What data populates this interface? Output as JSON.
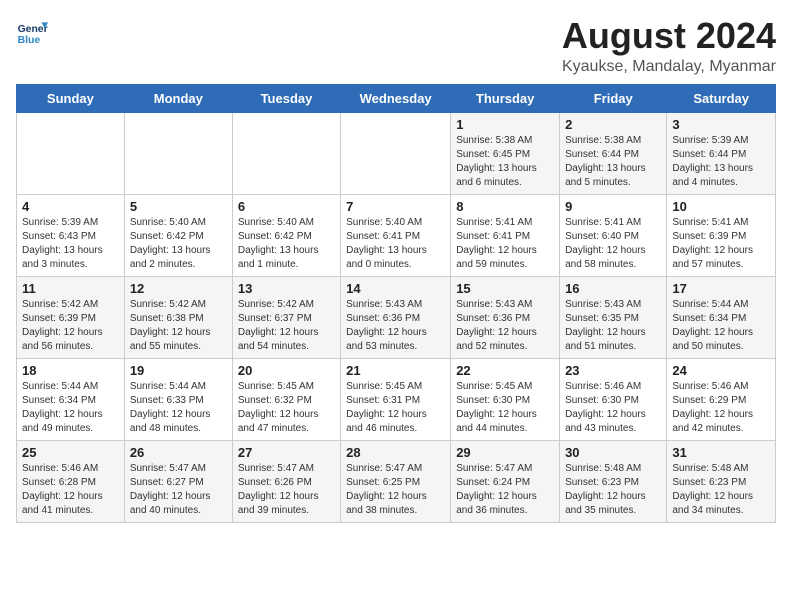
{
  "header": {
    "logo_line1": "General",
    "logo_line2": "Blue",
    "title": "August 2024",
    "subtitle": "Kyaukse, Mandalay, Myanmar"
  },
  "weekdays": [
    "Sunday",
    "Monday",
    "Tuesday",
    "Wednesday",
    "Thursday",
    "Friday",
    "Saturday"
  ],
  "weeks": [
    [
      {
        "day": "",
        "info": ""
      },
      {
        "day": "",
        "info": ""
      },
      {
        "day": "",
        "info": ""
      },
      {
        "day": "",
        "info": ""
      },
      {
        "day": "1",
        "info": "Sunrise: 5:38 AM\nSunset: 6:45 PM\nDaylight: 13 hours\nand 6 minutes."
      },
      {
        "day": "2",
        "info": "Sunrise: 5:38 AM\nSunset: 6:44 PM\nDaylight: 13 hours\nand 5 minutes."
      },
      {
        "day": "3",
        "info": "Sunrise: 5:39 AM\nSunset: 6:44 PM\nDaylight: 13 hours\nand 4 minutes."
      }
    ],
    [
      {
        "day": "4",
        "info": "Sunrise: 5:39 AM\nSunset: 6:43 PM\nDaylight: 13 hours\nand 3 minutes."
      },
      {
        "day": "5",
        "info": "Sunrise: 5:40 AM\nSunset: 6:42 PM\nDaylight: 13 hours\nand 2 minutes."
      },
      {
        "day": "6",
        "info": "Sunrise: 5:40 AM\nSunset: 6:42 PM\nDaylight: 13 hours\nand 1 minute."
      },
      {
        "day": "7",
        "info": "Sunrise: 5:40 AM\nSunset: 6:41 PM\nDaylight: 13 hours\nand 0 minutes."
      },
      {
        "day": "8",
        "info": "Sunrise: 5:41 AM\nSunset: 6:41 PM\nDaylight: 12 hours\nand 59 minutes."
      },
      {
        "day": "9",
        "info": "Sunrise: 5:41 AM\nSunset: 6:40 PM\nDaylight: 12 hours\nand 58 minutes."
      },
      {
        "day": "10",
        "info": "Sunrise: 5:41 AM\nSunset: 6:39 PM\nDaylight: 12 hours\nand 57 minutes."
      }
    ],
    [
      {
        "day": "11",
        "info": "Sunrise: 5:42 AM\nSunset: 6:39 PM\nDaylight: 12 hours\nand 56 minutes."
      },
      {
        "day": "12",
        "info": "Sunrise: 5:42 AM\nSunset: 6:38 PM\nDaylight: 12 hours\nand 55 minutes."
      },
      {
        "day": "13",
        "info": "Sunrise: 5:42 AM\nSunset: 6:37 PM\nDaylight: 12 hours\nand 54 minutes."
      },
      {
        "day": "14",
        "info": "Sunrise: 5:43 AM\nSunset: 6:36 PM\nDaylight: 12 hours\nand 53 minutes."
      },
      {
        "day": "15",
        "info": "Sunrise: 5:43 AM\nSunset: 6:36 PM\nDaylight: 12 hours\nand 52 minutes."
      },
      {
        "day": "16",
        "info": "Sunrise: 5:43 AM\nSunset: 6:35 PM\nDaylight: 12 hours\nand 51 minutes."
      },
      {
        "day": "17",
        "info": "Sunrise: 5:44 AM\nSunset: 6:34 PM\nDaylight: 12 hours\nand 50 minutes."
      }
    ],
    [
      {
        "day": "18",
        "info": "Sunrise: 5:44 AM\nSunset: 6:34 PM\nDaylight: 12 hours\nand 49 minutes."
      },
      {
        "day": "19",
        "info": "Sunrise: 5:44 AM\nSunset: 6:33 PM\nDaylight: 12 hours\nand 48 minutes."
      },
      {
        "day": "20",
        "info": "Sunrise: 5:45 AM\nSunset: 6:32 PM\nDaylight: 12 hours\nand 47 minutes."
      },
      {
        "day": "21",
        "info": "Sunrise: 5:45 AM\nSunset: 6:31 PM\nDaylight: 12 hours\nand 46 minutes."
      },
      {
        "day": "22",
        "info": "Sunrise: 5:45 AM\nSunset: 6:30 PM\nDaylight: 12 hours\nand 44 minutes."
      },
      {
        "day": "23",
        "info": "Sunrise: 5:46 AM\nSunset: 6:30 PM\nDaylight: 12 hours\nand 43 minutes."
      },
      {
        "day": "24",
        "info": "Sunrise: 5:46 AM\nSunset: 6:29 PM\nDaylight: 12 hours\nand 42 minutes."
      }
    ],
    [
      {
        "day": "25",
        "info": "Sunrise: 5:46 AM\nSunset: 6:28 PM\nDaylight: 12 hours\nand 41 minutes."
      },
      {
        "day": "26",
        "info": "Sunrise: 5:47 AM\nSunset: 6:27 PM\nDaylight: 12 hours\nand 40 minutes."
      },
      {
        "day": "27",
        "info": "Sunrise: 5:47 AM\nSunset: 6:26 PM\nDaylight: 12 hours\nand 39 minutes."
      },
      {
        "day": "28",
        "info": "Sunrise: 5:47 AM\nSunset: 6:25 PM\nDaylight: 12 hours\nand 38 minutes."
      },
      {
        "day": "29",
        "info": "Sunrise: 5:47 AM\nSunset: 6:24 PM\nDaylight: 12 hours\nand 36 minutes."
      },
      {
        "day": "30",
        "info": "Sunrise: 5:48 AM\nSunset: 6:23 PM\nDaylight: 12 hours\nand 35 minutes."
      },
      {
        "day": "31",
        "info": "Sunrise: 5:48 AM\nSunset: 6:23 PM\nDaylight: 12 hours\nand 34 minutes."
      }
    ]
  ]
}
